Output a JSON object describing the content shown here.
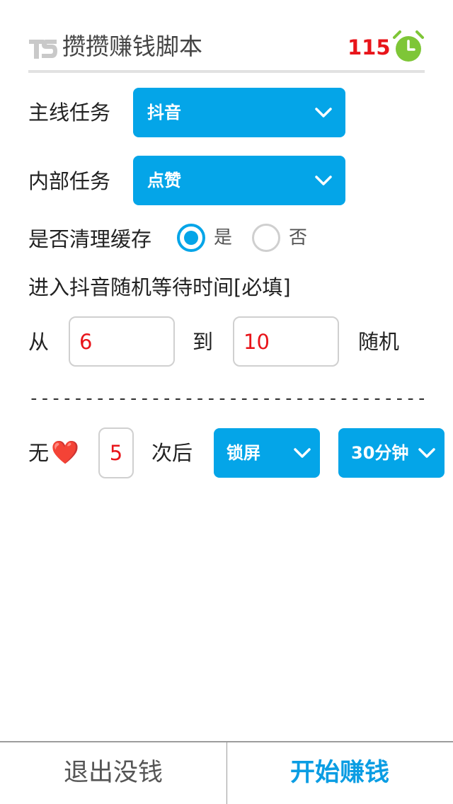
{
  "header": {
    "title": "攒攒赚钱脚本",
    "counter": "115",
    "logo_icon": "ts-logo-icon",
    "alarm_icon": "alarm-clock-icon",
    "alarm_color": "#7ec637"
  },
  "main_task": {
    "label": "主线任务",
    "selected": "抖音"
  },
  "inner_task": {
    "label": "内部任务",
    "selected": "点赞"
  },
  "clear_cache": {
    "label": "是否清理缓存",
    "options": [
      "是",
      "否"
    ],
    "selected": "是"
  },
  "wait_time": {
    "label": "进入抖音随机等待时间[必填]",
    "from_label": "从",
    "from_value": "6",
    "to_label": "到",
    "to_value": "10",
    "suffix": "随机"
  },
  "separator": "-------------------------------------",
  "no_like": {
    "prefix": "无",
    "heart": "❤️",
    "count": "5",
    "after_label": "次后",
    "action_selected": "锁屏",
    "duration_selected": "30分钟"
  },
  "footer": {
    "exit_label": "退出没钱",
    "start_label": "开始赚钱"
  },
  "colors": {
    "accent": "#04a5e8",
    "value_red": "#e8141a",
    "start_blue": "#0a9de3"
  }
}
